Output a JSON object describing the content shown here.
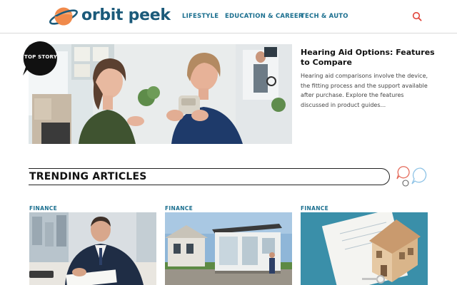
{
  "header": {
    "logo_text": "orbit peek",
    "nav": [
      "LIFESTYLE",
      "EDUCATION & CAREER",
      "TECH & AUTO"
    ],
    "search_icon": "search-icon"
  },
  "top_story": {
    "badge": "TOP STORY",
    "title": "Hearing Aid Options: Features to Compare",
    "excerpt": "Hearing aid comparisons involve the device, the fitting process and the support available after purchase. Explore the features discussed in product guides..."
  },
  "trending": {
    "title": "TRENDING ARTICLES",
    "cards": [
      {
        "category": "FINANCE"
      },
      {
        "category": "FINANCE"
      },
      {
        "category": "FINANCE"
      }
    ]
  },
  "colors": {
    "brand": "#1b5a7a",
    "nav": "#1b6f8f",
    "logo_orange": "#f08a4b",
    "search": "#e0443a",
    "deco_red": "#e46a5a",
    "deco_blue": "#8ec3e6"
  }
}
